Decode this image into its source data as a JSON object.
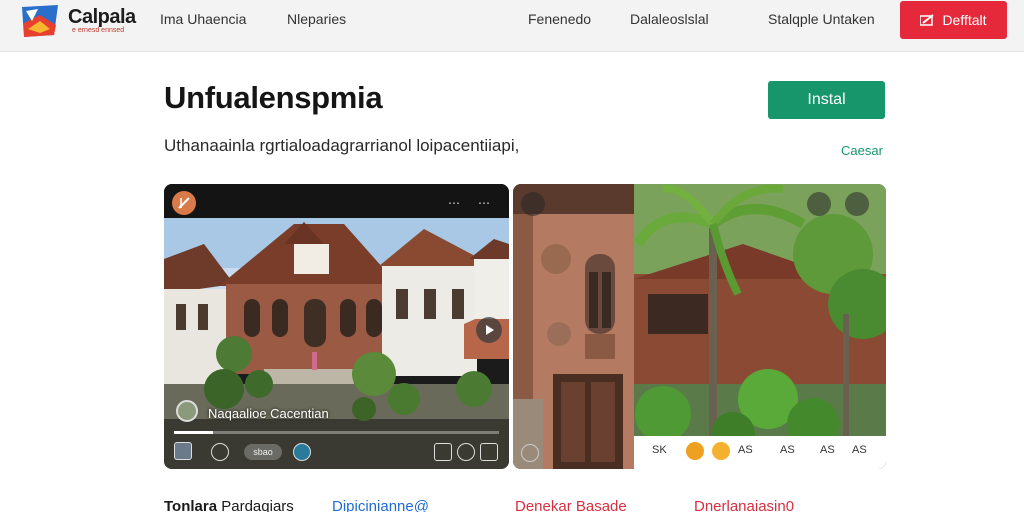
{
  "nav": {
    "brand": "Calpala",
    "brand_sub": "e ernesd  ennsed",
    "links": [
      "Ima Uhaencia",
      "Nleparies",
      "Fenenedo",
      "Dalaleoslslal",
      "Stalqple Untaken"
    ],
    "cta_label": "Defftalt",
    "cta_icon": "edit-icon"
  },
  "hero": {
    "title": "Unfualenspmia",
    "subtitle": "Uthanaainla rgrtialoadagrarrianol loipacentiiapi,",
    "install_label": "Instal",
    "more_link": "Caesar"
  },
  "cards": [
    {
      "caption": "Naqaalioe Cacentian",
      "controls": [
        "play-icon",
        "sbao",
        "volume-icon"
      ],
      "progress": 0.12,
      "menu_icon": "more-dots-icon"
    },
    {
      "controls": [
        "back-icon",
        "settings-icon",
        "share-icon"
      ],
      "footer_icons": [
        "SK",
        "AS",
        "AS",
        "AS",
        "AS"
      ]
    }
  ],
  "footer": {
    "link1_bold": "Tonlara",
    "link1_rest": " Pardaqiars",
    "link2": "Dipicinianne@",
    "link3": "Denekar Basade",
    "link4": "Dnerlanaiasin0"
  },
  "colors": {
    "cta": "#e5293a",
    "install": "#16966a",
    "link_blue": "#1f6bd1",
    "link_red": "#d63040"
  }
}
